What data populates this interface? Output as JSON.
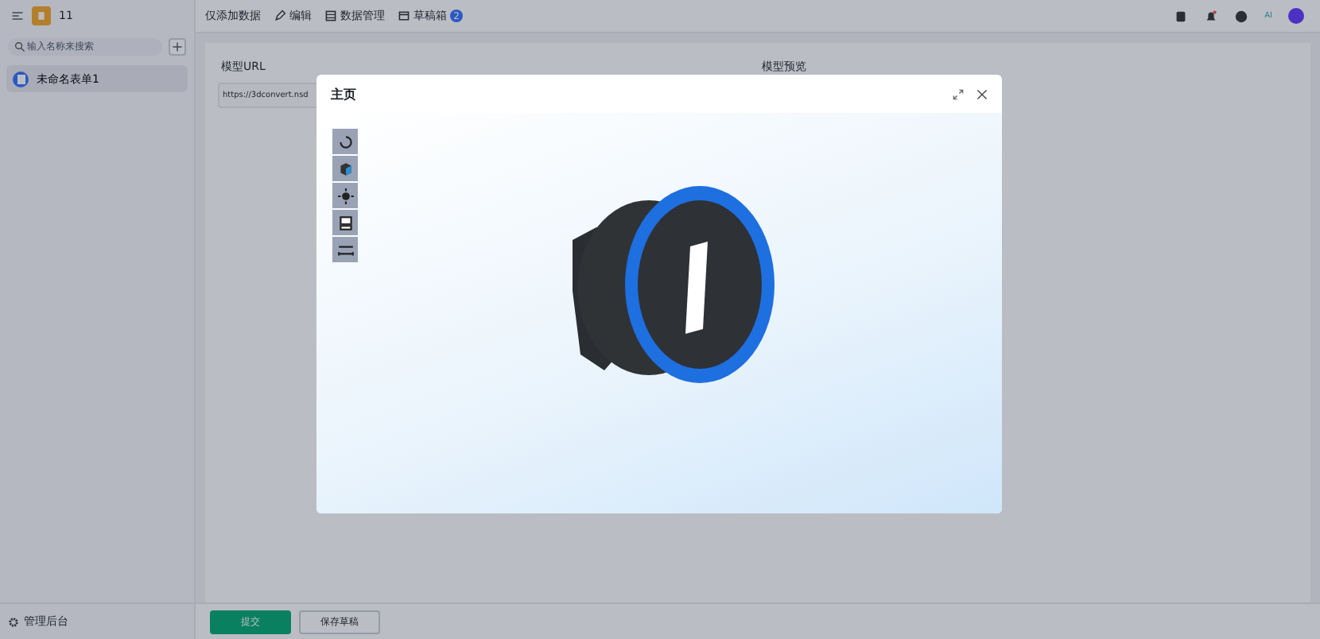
{
  "sidebar": {
    "app_name": "11",
    "search": {
      "placeholder": "输入名称来搜索"
    },
    "items": [
      {
        "label": "未命名表单1",
        "selected": true
      }
    ],
    "footer": "管理后台"
  },
  "toolbar": {
    "title": "仅添加数据",
    "actions": [
      {
        "label": "编辑",
        "kind": "edit"
      },
      {
        "label": "数据管理",
        "kind": "data"
      },
      {
        "label": "草稿箱",
        "kind": "draft",
        "badge": "2"
      }
    ],
    "help_badge": "AI"
  },
  "form": {
    "fields": [
      {
        "label": "模型URL",
        "value": "https://3dconvert.nsd"
      },
      {
        "label": "模型预览"
      }
    ],
    "buttons": [
      {
        "label": "提交",
        "kind": "primary"
      },
      {
        "label": "保存草稿",
        "kind": "secondary"
      }
    ]
  },
  "modal": {
    "title": "主页",
    "tools": [
      {
        "kind": "rotate"
      },
      {
        "kind": "cube"
      },
      {
        "kind": "light"
      },
      {
        "kind": "screen"
      },
      {
        "kind": "measure"
      }
    ]
  }
}
